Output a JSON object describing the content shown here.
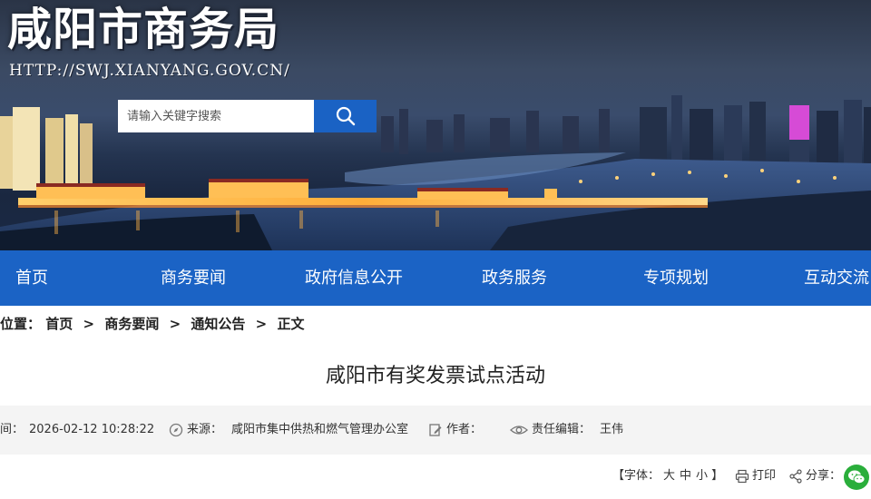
{
  "site": {
    "title": "咸阳市商务局",
    "url": "HTTP://SWJ.XIANYANG.GOV.CN/"
  },
  "search": {
    "placeholder": "请输入关键字搜索",
    "icon": "search-icon"
  },
  "nav": {
    "items": [
      {
        "label": "首页"
      },
      {
        "label": "商务要闻"
      },
      {
        "label": "政府信息公开"
      },
      {
        "label": "政务服务"
      },
      {
        "label": "专项规划"
      },
      {
        "label": "互动交流"
      }
    ]
  },
  "breadcrumb": {
    "prefix": "位置：",
    "items": [
      "首页",
      "商务要闻",
      "通知公告",
      "正文"
    ],
    "separator": ">"
  },
  "article": {
    "title": "咸阳市有奖发票试点活动",
    "meta": {
      "time_label": "间：",
      "time_value": "2026-02-12 10:28:22",
      "source_label": "来源：",
      "source_value": "咸阳市集中供热和燃气管理办公室",
      "author_label": "作者：",
      "author_value": "",
      "editor_label": "责任编辑：",
      "editor_value": "王伟"
    },
    "tools": {
      "font_prefix": "【字体：",
      "font_large": "大",
      "font_medium": "中",
      "font_small": "小",
      "font_suffix": "】",
      "print_label": "打印",
      "share_label": "分享："
    }
  },
  "colors": {
    "nav_bg": "#1b63c5",
    "search_button": "#1a62c4",
    "meta_bar_bg": "#f4f4f4",
    "wechat_green": "#2aae3b"
  }
}
